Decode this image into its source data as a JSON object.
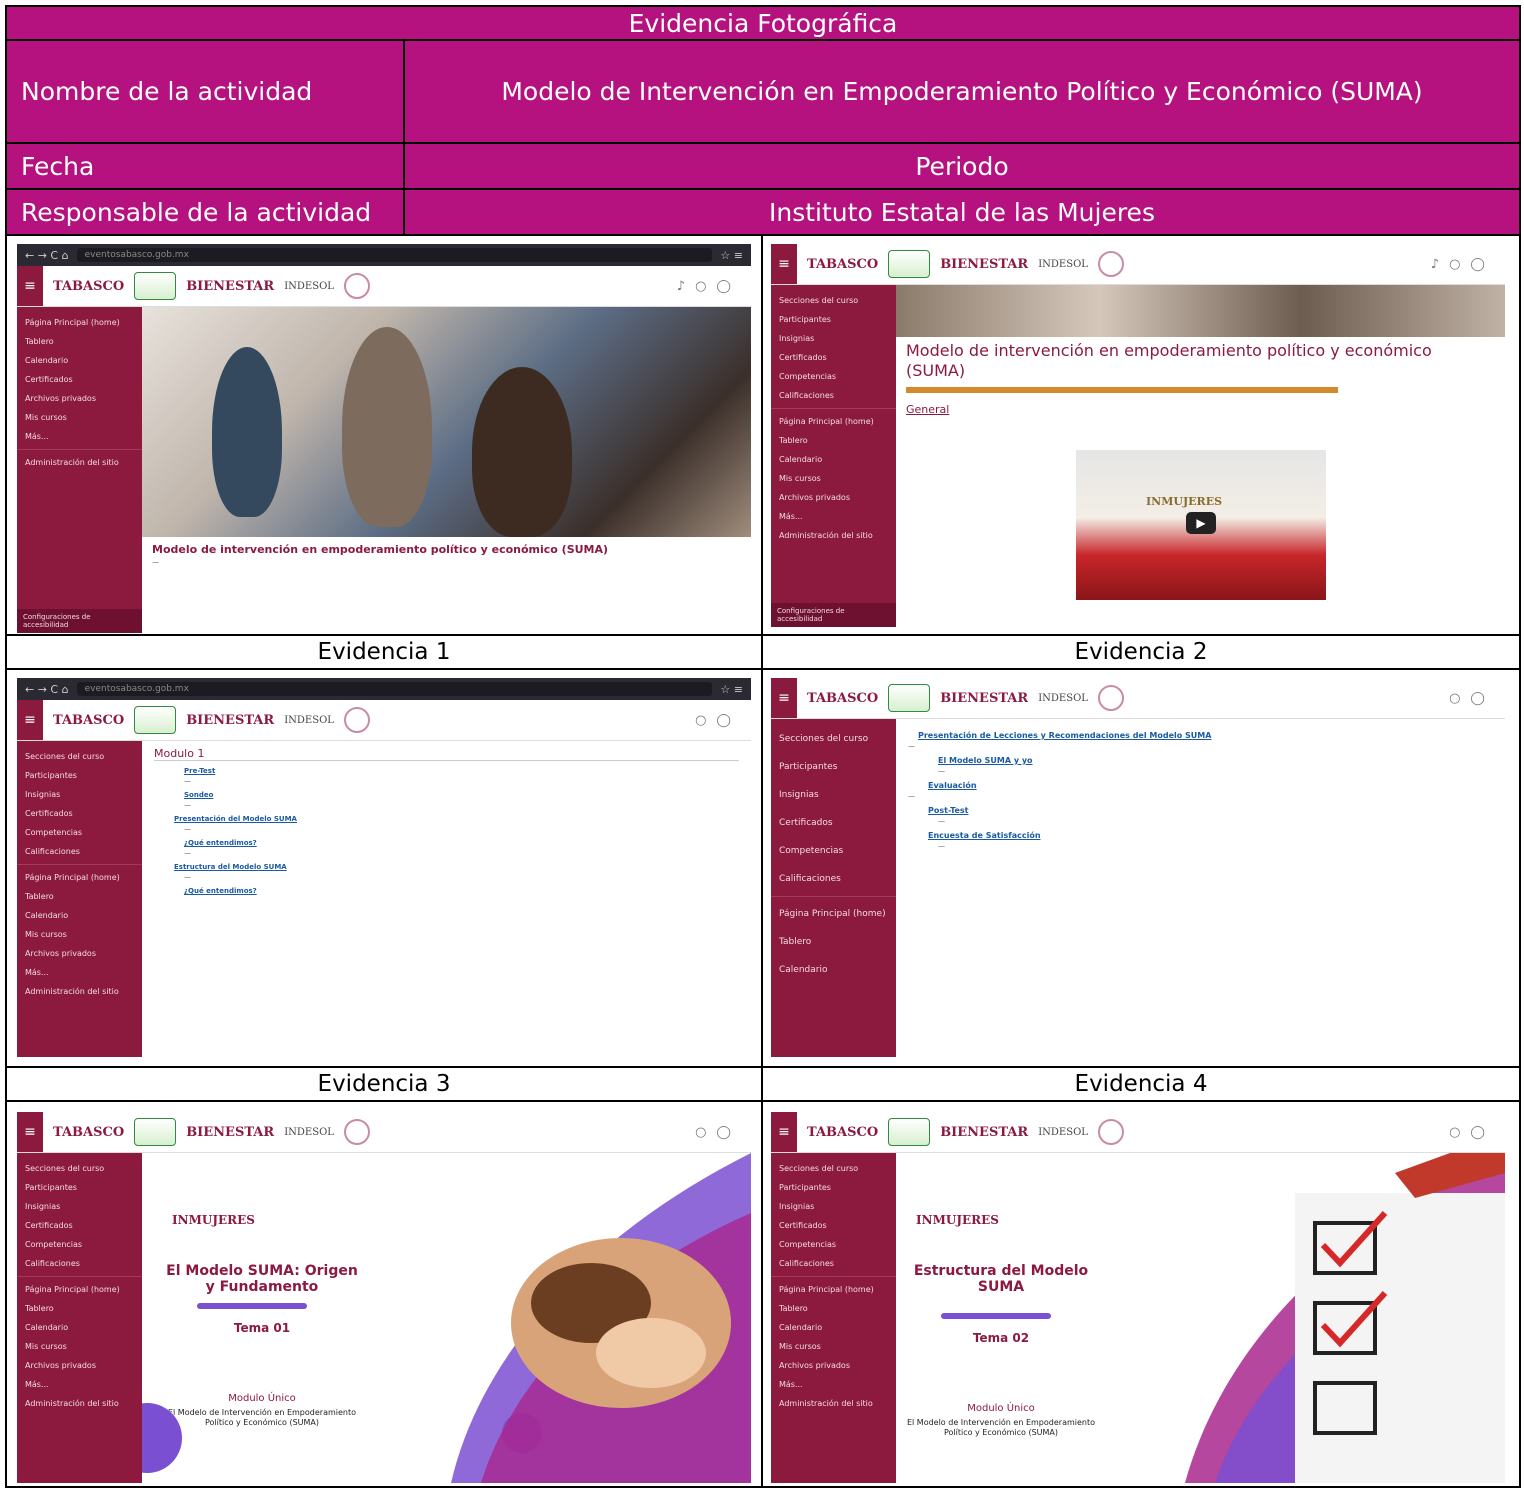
{
  "header": {
    "title": "Evidencia Fotográfica",
    "activity_label": "Nombre de la actividad",
    "activity_value": "Modelo de Intervención en Empoderamiento Político y Económico (SUMA)",
    "date_label": "Fecha",
    "period_label": "Periodo",
    "responsible_label": "Responsable de la actividad",
    "responsible_value": "Instituto Estatal de las Mujeres"
  },
  "captions": [
    "Evidencia 1",
    "Evidencia 2",
    "Evidencia 3",
    "Evidencia 4"
  ],
  "logos": {
    "tabasco": "TABASCO",
    "bienestar": "BIENESTAR",
    "indesol": "INDESOL",
    "inmujeres": "INMUJERES"
  },
  "ev1": {
    "sidebar": [
      "Página Principal (home)",
      "Tablero",
      "Calendario",
      "Certificados",
      "Archivos privados",
      "Mis cursos",
      "Más...",
      "Administración del sitio"
    ],
    "footer": "Configuraciones de accesibilidad",
    "title": "Modelo de intervención en empoderamiento político y económico (SUMA)"
  },
  "ev2": {
    "sidebar": [
      "Secciones del curso",
      "Participantes",
      "Insignias",
      "Certificados",
      "Competencias",
      "Calificaciones",
      "Página Principal (home)",
      "Tablero",
      "Calendario",
      "Mis cursos",
      "Archivos privados",
      "Más...",
      "Administración del sitio"
    ],
    "footer": "Configuraciones de accesibilidad",
    "title": "Modelo de intervención en empoderamiento político y económico (SUMA)",
    "general": "General"
  },
  "ev3": {
    "sidebar": [
      "Secciones del curso",
      "Participantes",
      "Insignias",
      "Certificados",
      "Competencias",
      "Calificaciones",
      "Página Principal (home)",
      "Tablero",
      "Calendario",
      "Mis cursos",
      "Archivos privados",
      "Más...",
      "Administración del sitio"
    ],
    "module": "Modulo 1",
    "items": [
      "Pre-Test",
      "Sondeo",
      "Presentación del Modelo SUMA",
      "¿Qué entendimos?",
      "Estructura del Modelo SUMA",
      "¿Qué entendimos?"
    ]
  },
  "ev4": {
    "sidebar": [
      "Secciones del curso",
      "Participantes",
      "Insignias",
      "Certificados",
      "Competencias",
      "Calificaciones",
      "Página Principal (home)",
      "Tablero",
      "Calendario"
    ],
    "items": [
      "Presentación de Lecciones y Recomendaciones del Modelo SUMA",
      "El Modelo SUMA y yo",
      "Evaluación",
      "Post-Test",
      "Encuesta de Satisfacción"
    ]
  },
  "ev5": {
    "sidebar": [
      "Secciones del curso",
      "Participantes",
      "Insignias",
      "Certificados",
      "Competencias",
      "Calificaciones",
      "Página Principal (home)",
      "Tablero",
      "Calendario",
      "Mis cursos",
      "Archivos privados",
      "Más...",
      "Administración del sitio"
    ],
    "title": "El Modelo SUMA: Origen y Fundamento",
    "tema": "Tema 01",
    "modulo": "Modulo Único",
    "modulo_sub": "El Modelo de Intervención en Empoderamiento Político y Económico (SUMA)"
  },
  "ev6": {
    "title": "Estructura del Modelo SUMA",
    "tema": "Tema 02",
    "modulo": "Modulo Único",
    "modulo_sub": "El Modelo de Intervención en Empoderamiento Político y Económico (SUMA)"
  }
}
